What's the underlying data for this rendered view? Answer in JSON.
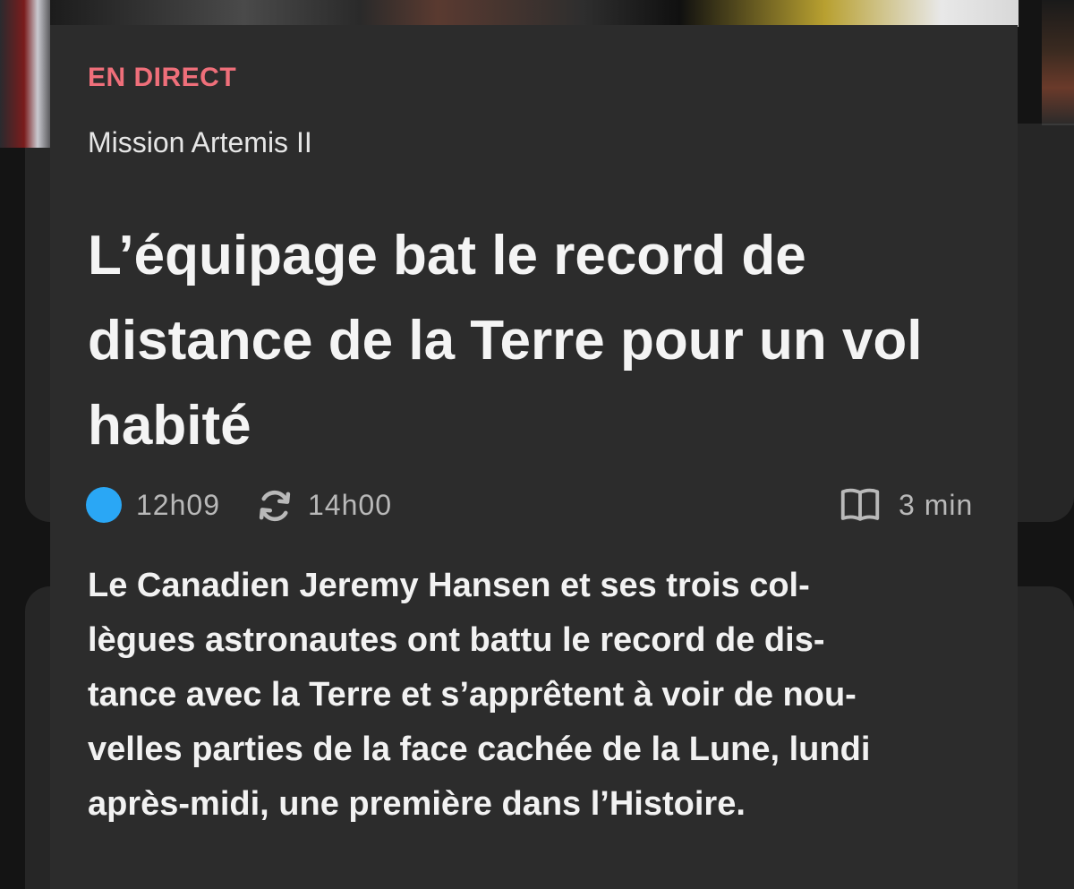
{
  "article": {
    "live_label": "EN DIRECT",
    "kicker": "Mission Artemis II",
    "headline": "L’équipage bat le record de distance de la Terre pour un vol habité",
    "meta": {
      "published_time": "12h09",
      "updated_time": "14h00",
      "read_time": "3 min"
    },
    "lede_lines": [
      "Le Canadien Jeremy Hansen et ses trois col-",
      "lègues astronautes ont battu le record de dis-",
      "tance avec la Terre et s’apprêtent à voir de nou-",
      "velles parties de la face cachée de la Lune, lundi",
      "après-midi, une première dans l’Histoire."
    ]
  },
  "icons": {
    "live_dot": "live-indicator-icon",
    "updated": "refresh-icon",
    "read_time": "book-icon"
  },
  "colors": {
    "live_label": "#ef6f7a",
    "live_dot": "#2aa7f5",
    "card_background": "#2c2c2c",
    "page_background": "#141414"
  }
}
